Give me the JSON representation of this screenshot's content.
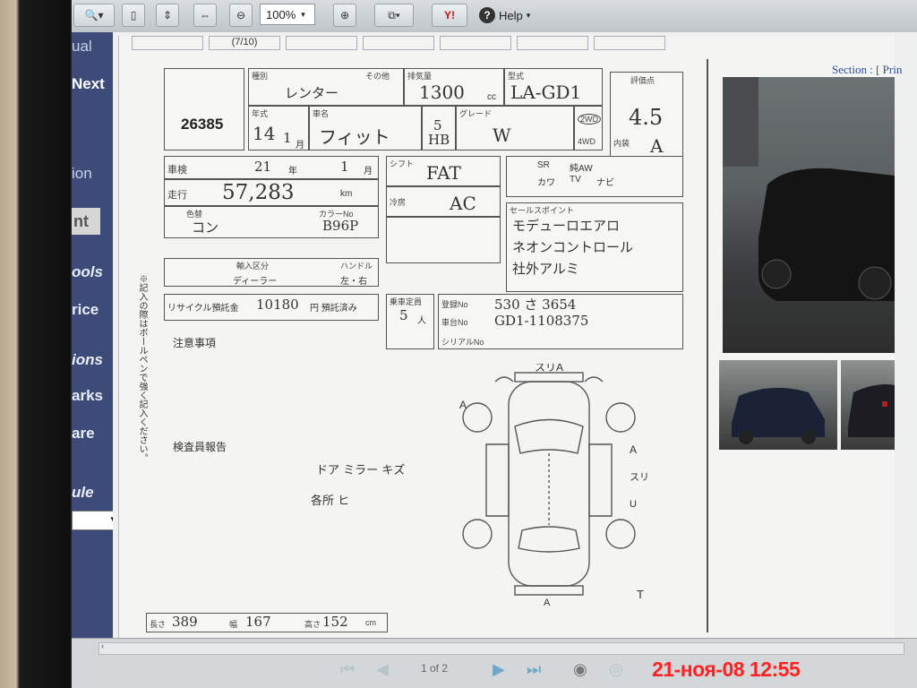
{
  "toolbar": {
    "zoom_value": "100%",
    "help_label": "Help"
  },
  "left_nav": {
    "items": [
      "ual",
      "Next",
      "ion",
      "nt",
      "ools",
      "rice",
      "ions",
      "arks",
      "are",
      "ule"
    ]
  },
  "document": {
    "page_indicator": "(7/10)",
    "section_label": "Section : [ Prin"
  },
  "sheet": {
    "lot_number": "26385",
    "category_label": "種別",
    "category_value": "レンター",
    "other_label": "その他",
    "displacement_label": "排気量",
    "displacement": "1300",
    "displacement_unit": "cc",
    "model_label": "型式",
    "model_code": "LA-GD1",
    "grade_score_label": "評価点",
    "grade_score": "4.5",
    "interior_label": "内装",
    "interior_score": "A",
    "year_label": "年式",
    "year_value": "14",
    "month_value": "1",
    "month_unit": "月",
    "car_name_label": "車名",
    "car_name": "フィット",
    "doors": "5",
    "body_type": "HB",
    "grade_label": "グレード",
    "grade": "W",
    "drive_2wd": "2WD",
    "drive_4wd": "4WD",
    "inspection_label": "車検",
    "inspection_year": "21",
    "inspection_year_unit": "年",
    "inspection_month": "1",
    "inspection_month_unit": "月",
    "mileage_label": "走行",
    "mileage": "57,283",
    "mileage_unit": "km",
    "shift_label": "シフト",
    "shift": "FAT",
    "ac_label": "冷房",
    "ac": "AC",
    "color_label": "色替",
    "color_value": "コン",
    "color_code_label": "カラーNo",
    "color_code": "B96P",
    "equipment": [
      "SR",
      "純AW",
      "カワ",
      "TV",
      "ナビ"
    ],
    "sales_points_label": "セールスポイント",
    "sales_points": [
      "モデューロエアロ",
      "ネオンコントロール",
      "社外アルミ"
    ],
    "import_label": "輸入区分",
    "import_value": "ディーラー",
    "steering_label": "ハンドル",
    "steering_value": "左・右",
    "recycle_label": "リサイクル預託金",
    "recycle_amount": "10180",
    "recycle_unit": "円 預託済み",
    "capacity_label": "乗車定員",
    "capacity": "5",
    "capacity_unit": "人",
    "reg_label": "登録No",
    "reg_value": "530 さ 3654",
    "chassis_label": "車台No",
    "chassis_value": "GD1-1108375",
    "serial_label": "シリアルNo",
    "notes_label": "注意事項",
    "inspector_label": "検査員報告",
    "inspector_note_1": "ドア ミラー キズ",
    "inspector_note_2": "各所 ヒ",
    "length_label": "長さ",
    "length": "389",
    "width_label": "幅",
    "width": "167",
    "height_label": "高さ",
    "height": "152",
    "dim_unit": "cm",
    "vertical_note": "※記入の際はボールペンで強く記入ください。",
    "diagram_marks": [
      "スリA",
      "A",
      "A",
      "スリA",
      "U",
      "T",
      "A"
    ]
  },
  "bottom": {
    "page_text": "1 of 2"
  },
  "timestamp": "21-ноя-08 12:55"
}
